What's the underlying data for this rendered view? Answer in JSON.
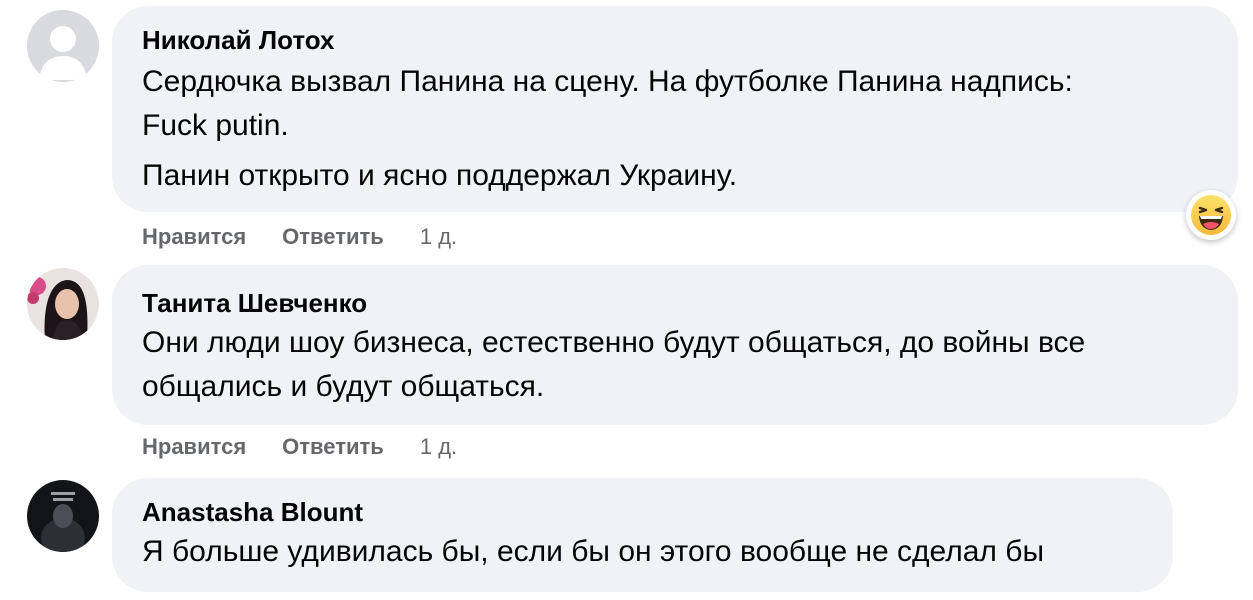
{
  "comments": [
    {
      "author": "Николай Лотох",
      "avatar": "default-avatar-icon",
      "paragraphs": [
        "Сердючка вызвал Панина на сцену. На футболке Панина надпись:",
        "Fuck putin.",
        "Панин открыто и ясно поддержал Украину."
      ],
      "like_label": "Нравится",
      "reply_label": "Ответить",
      "time": "1 д.",
      "reaction": "haha-emoji-icon"
    },
    {
      "author": "Танита Шевченко",
      "avatar": "profile-photo-woman",
      "paragraphs": [
        "Они люди шоу бизнеса, естественно будут общаться, до войны все",
        "общались и будут общаться."
      ],
      "like_label": "Нравится",
      "reply_label": "Ответить",
      "time": "1 д."
    },
    {
      "author": "Anastasha Blount",
      "avatar": "profile-photo-dark",
      "paragraphs": [
        "Я больше удивилась бы, если бы он этого вообще не сделал бы"
      ]
    }
  ],
  "colors": {
    "bubble": "#f0f2f5",
    "text": "#050505",
    "secondary": "#65676b"
  }
}
